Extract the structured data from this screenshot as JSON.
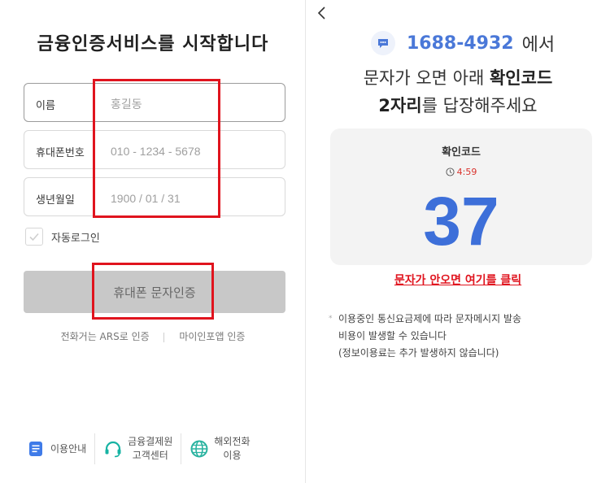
{
  "left": {
    "title": "금융인증서비스를 시작합니다",
    "fields": [
      {
        "label": "이름",
        "placeholder": "홍길동"
      },
      {
        "label": "휴대폰번호",
        "placeholder": "010 - 1234 - 5678"
      },
      {
        "label": "생년월일",
        "placeholder": "1900 / 01 / 31"
      }
    ],
    "auto_login": {
      "label": "자동로그인",
      "checked": false
    },
    "sms_button": "휴대폰 문자인증",
    "alt_links": {
      "ars": "전화거는 ARS로 인증",
      "myinfo": "마이인포앱 인증"
    },
    "footer": [
      {
        "icon": "document-icon",
        "text_line1": "이용안내",
        "text_line2": ""
      },
      {
        "icon": "headset-icon",
        "text_line1": "금융결제원",
        "text_line2": "고객센터"
      },
      {
        "icon": "globe-icon",
        "text_line1": "해외전화",
        "text_line2": "이용"
      }
    ],
    "highlight_color": "#e0141e"
  },
  "right": {
    "phone_number": "1688-4932",
    "phone_suffix": "에서",
    "message_line1_prefix": "문자가 오면 아래 ",
    "message_line1_bold": "확인코드",
    "message_line2_bold": "2자리",
    "message_line2_suffix": "를 답장해주세요",
    "code_card": {
      "title": "확인코드",
      "timer": "4:59",
      "code": "37"
    },
    "resend_link": "문자가 안오면 여기를 클릭",
    "notice_line1": "이용중인 통신요금제에 따라 문자메시지 발송",
    "notice_line2": "비용이 발생할 수 있습니다",
    "notice_line3": "(정보이용료는 추가 발생하지 않습니다)",
    "accent_color": "#3d6fd9"
  }
}
